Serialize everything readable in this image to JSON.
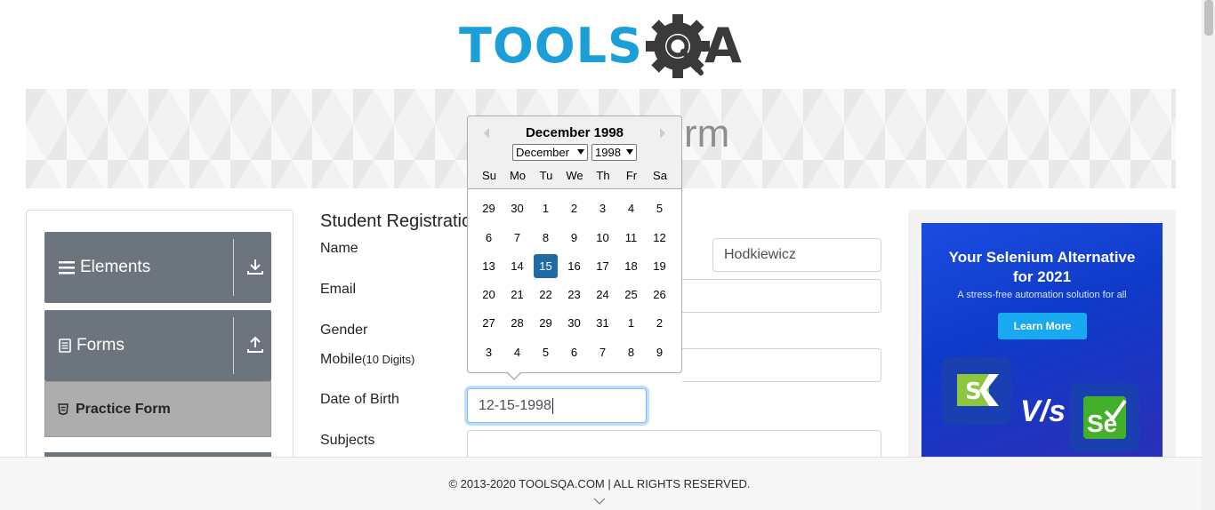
{
  "logo": {
    "left_text": "TOOLS",
    "right_text": "A"
  },
  "banner": {
    "title": "Practice Form",
    "visible_title": "rm"
  },
  "nav": {
    "groups": [
      {
        "label": "Elements",
        "icon": "menu-lines-icon",
        "toggle_icon": "download-arrow-icon"
      },
      {
        "label": "Forms",
        "icon": "document-icon",
        "toggle_icon": "upload-arrow-icon"
      }
    ],
    "active_item": {
      "label": "Practice Form",
      "icon": "html5-icon"
    }
  },
  "form": {
    "heading": "Student Registratic",
    "labels": {
      "name": "Name",
      "email": "Email",
      "gender": "Gender",
      "mobile": "Mobile",
      "mobile_hint": "(10 Digits)",
      "dob": "Date of Birth",
      "subjects": "Subjects"
    },
    "values": {
      "last_name": "Hodkiewicz",
      "dob": "12-15-1998"
    }
  },
  "calendar": {
    "title": "December 1998",
    "month_select": "December",
    "year_select": "1998",
    "weekdays": [
      "Su",
      "Mo",
      "Tu",
      "We",
      "Th",
      "Fr",
      "Sa"
    ],
    "weeks": [
      [
        "29",
        "30",
        "1",
        "2",
        "3",
        "4",
        "5"
      ],
      [
        "6",
        "7",
        "8",
        "9",
        "10",
        "11",
        "12"
      ],
      [
        "13",
        "14",
        "15",
        "16",
        "17",
        "18",
        "19"
      ],
      [
        "20",
        "21",
        "22",
        "23",
        "24",
        "25",
        "26"
      ],
      [
        "27",
        "28",
        "29",
        "30",
        "31",
        "1",
        "2"
      ],
      [
        "3",
        "4",
        "5",
        "6",
        "7",
        "8",
        "9"
      ]
    ],
    "selected": "15"
  },
  "ad": {
    "title_line1": "Your Selenium Alternative",
    "title_line2": "for 2021",
    "subtitle": "A stress-free automation solution for all",
    "button": "Learn More",
    "vs": "V/s",
    "logo_right": "Se"
  },
  "footer": {
    "text": "© 2013-2020 TOOLSQA.COM | ALL RIGHTS RESERVED."
  },
  "colors": {
    "logo_blue": "#1a9fd9",
    "logo_dark": "#3a3a3a",
    "nav_group": "#6c757d",
    "active_item": "#adadad",
    "selected_day": "#216ba5",
    "ad_button": "#19a9f0"
  }
}
